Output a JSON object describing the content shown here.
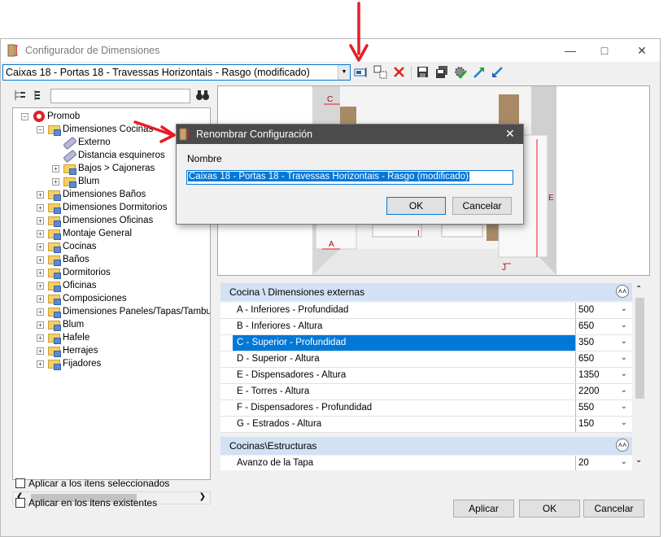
{
  "window": {
    "title": "Configurador de Dimensiones"
  },
  "toolbar": {
    "config_selected": "Caixas 18 - Portas 18 - Travessas Horizontais - Rasgo (modificado)"
  },
  "tree": {
    "items": [
      {
        "label": "Promob",
        "level": 0,
        "expander": "−",
        "icon": "promob-logo-icon"
      },
      {
        "label": "Dimensiones Cocinas",
        "level": 1,
        "expander": "−",
        "icon": "folder-icon"
      },
      {
        "label": "Externo",
        "level": 2,
        "expander": "",
        "icon": "pen-icon"
      },
      {
        "label": "Distancia esquineros",
        "level": 2,
        "expander": "",
        "icon": "pen-icon"
      },
      {
        "label": "Bajos > Cajoneras",
        "level": 2,
        "expander": "+",
        "icon": "folder-icon"
      },
      {
        "label": "Blum",
        "level": 2,
        "expander": "+",
        "icon": "folder-icon"
      },
      {
        "label": "Dimensiones Baños",
        "level": 1,
        "expander": "+",
        "icon": "folder-icon"
      },
      {
        "label": "Dimensiones Dormitorios",
        "level": 1,
        "expander": "+",
        "icon": "folder-icon"
      },
      {
        "label": "Dimensiones Oficinas",
        "level": 1,
        "expander": "+",
        "icon": "folder-icon"
      },
      {
        "label": "Montaje General",
        "level": 1,
        "expander": "+",
        "icon": "folder-icon"
      },
      {
        "label": "Cocinas",
        "level": 1,
        "expander": "+",
        "icon": "folder-icon"
      },
      {
        "label": "Baños",
        "level": 1,
        "expander": "+",
        "icon": "folder-icon"
      },
      {
        "label": "Dormitorios",
        "level": 1,
        "expander": "+",
        "icon": "folder-icon"
      },
      {
        "label": "Oficinas",
        "level": 1,
        "expander": "+",
        "icon": "folder-icon"
      },
      {
        "label": "Composiciones",
        "level": 1,
        "expander": "+",
        "icon": "folder-icon"
      },
      {
        "label": "Dimensiones Paneles/Tapas/Tambur",
        "level": 1,
        "expander": "+",
        "icon": "folder-icon"
      },
      {
        "label": "Blum",
        "level": 1,
        "expander": "+",
        "icon": "folder-icon"
      },
      {
        "label": "Hafele",
        "level": 1,
        "expander": "+",
        "icon": "folder-icon"
      },
      {
        "label": "Herrajes",
        "level": 1,
        "expander": "+",
        "icon": "folder-icon"
      },
      {
        "label": "Fijadores",
        "level": 1,
        "expander": "+",
        "icon": "folder-icon"
      }
    ]
  },
  "checkboxes": {
    "apply_selected": "Aplicar a los itens seleccionados",
    "apply_existing": "Aplicar en los itens existentes"
  },
  "preview": {
    "labels": {
      "a": "A",
      "c": "C",
      "e": "E",
      "i": "I",
      "j": "J"
    }
  },
  "grid": {
    "section1": "Cocina \\ Dimensiones externas",
    "rows": [
      {
        "label": "A - Inferiores - Profundidad",
        "value": "500"
      },
      {
        "label": "B - Inferiores - Altura",
        "value": "650"
      },
      {
        "label": "C - Superior - Profundidad",
        "value": "350"
      },
      {
        "label": "D - Superior - Altura",
        "value": "650"
      },
      {
        "label": "E - Dispensadores - Altura",
        "value": "1350"
      },
      {
        "label": "E - Torres - Altura",
        "value": "2200"
      },
      {
        "label": "F - Dispensadores - Profundidad",
        "value": "550"
      },
      {
        "label": "G - Estrados - Altura",
        "value": "150"
      }
    ],
    "section2": "Cocinas\\Estructuras",
    "rows2": [
      {
        "label": "Avanzo de la Tapa",
        "value": "20"
      }
    ]
  },
  "buttons": {
    "apply": "Aplicar",
    "ok": "OK",
    "cancel": "Cancelar"
  },
  "dialog": {
    "title": "Renombrar Configuración",
    "field_label": "Nombre",
    "value": "Caixas 18 - Portas 18 - Travessas Horizontais - Rasgo (modificado)",
    "ok": "OK",
    "cancel": "Cancelar"
  },
  "colors": {
    "accent": "#0078d7",
    "annotation": "#e81c24",
    "section": "#d2e1f3",
    "dialog_bar": "#4b4b4b"
  }
}
